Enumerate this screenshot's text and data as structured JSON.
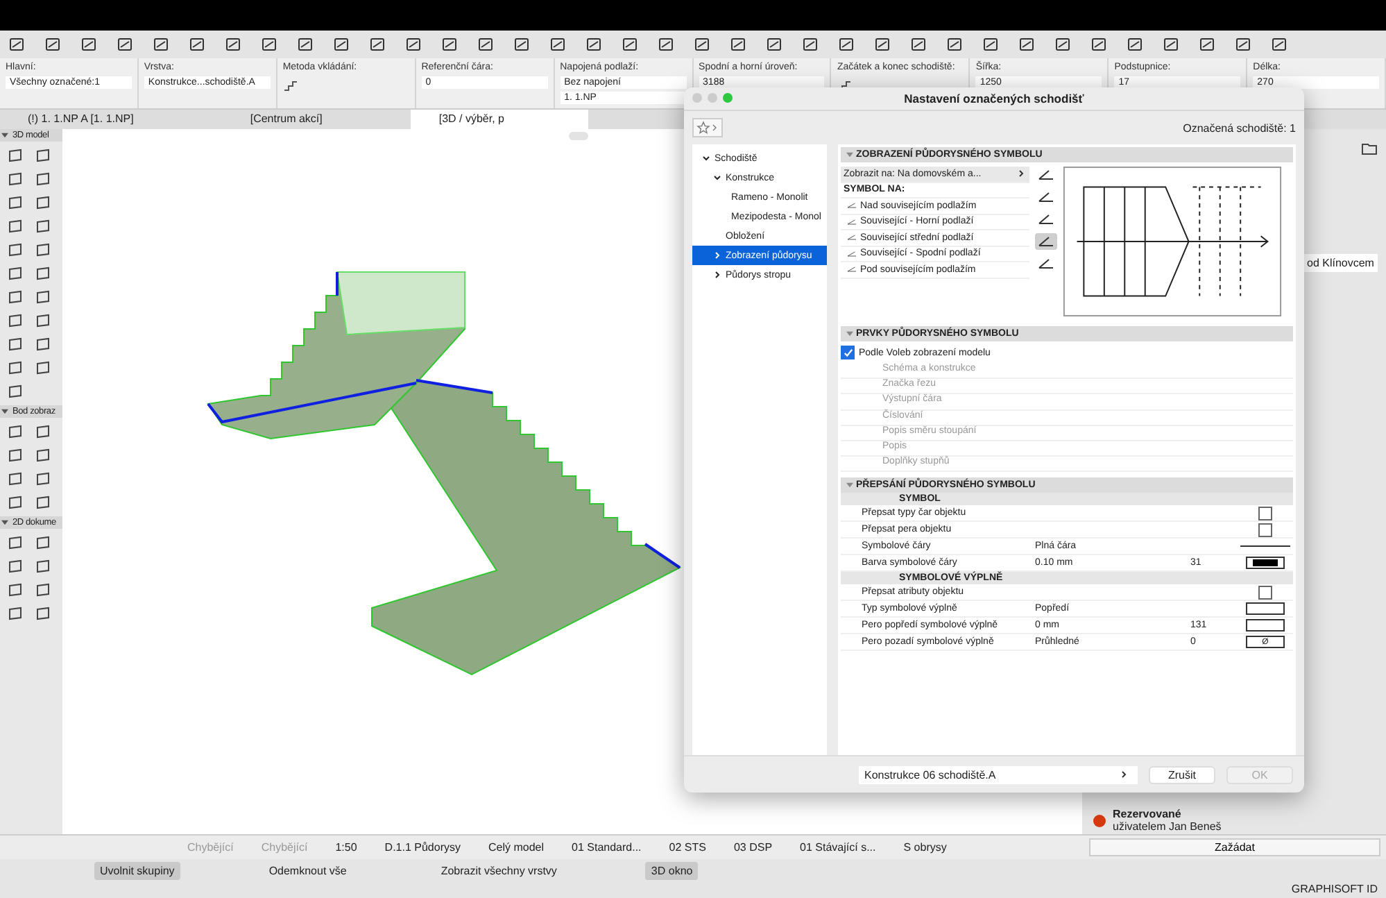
{
  "info_box": {
    "groups": [
      {
        "label": "Hlavní:",
        "values": [
          "Všechny označené:1"
        ]
      },
      {
        "label": "Vrstva:",
        "values": [
          "Konstrukce...schodiště.A"
        ]
      },
      {
        "label": "Metoda vkládání:"
      },
      {
        "label": "Referenční čára:",
        "values": [
          "0"
        ]
      },
      {
        "label": "Napojená podlaží:",
        "values": [
          "Bez napojení",
          "1. 1.NP"
        ]
      },
      {
        "label": "Spodní a horní úroveň:",
        "values": [
          "3188"
        ]
      },
      {
        "label": "Začátek a konec schodiště:"
      },
      {
        "label": "Šířka:",
        "values": [
          "1250"
        ]
      },
      {
        "label": "Podstupnice:",
        "values": [
          "17"
        ]
      },
      {
        "label": "Délka:",
        "values": [
          "270"
        ]
      }
    ]
  },
  "tabs": [
    {
      "label": "(!) 1. 1.NP A [1. 1.NP]",
      "selected": false
    },
    {
      "label": "[Centrum akcí]",
      "selected": false
    },
    {
      "label": "[3D / výběr, p",
      "selected": true
    }
  ],
  "toolbox": {
    "sections": [
      {
        "title": "3D model",
        "expanded": true
      },
      {
        "title": "Bod zobraz",
        "expanded": true
      },
      {
        "title": "2D dokume",
        "expanded": true
      }
    ]
  },
  "dialog": {
    "title": "Nastavení označených schodišť",
    "selection_count": "Označená schodiště: 1",
    "tree": [
      {
        "label": "Schodiště",
        "expanded": true,
        "selected": false,
        "children": [
          {
            "label": "Konstrukce",
            "expanded": true,
            "selected": false,
            "children": [
              {
                "label": "Rameno - Monolit",
                "selected": false
              },
              {
                "label": "Mezipodesta - Monol",
                "selected": false
              }
            ]
          },
          {
            "label": "Obložení",
            "selected": false
          },
          {
            "label": "Zobrazení půdorysu",
            "expanded": false,
            "selected": true
          },
          {
            "label": "Půdorys stropu",
            "expanded": false,
            "selected": false
          }
        ]
      }
    ],
    "plan_section": {
      "title": "ZOBRAZENÍ PŮDORYSNÉHO SYMBOLU",
      "show_on": "Zobrazit na: Na domovském a...",
      "symbol_heading": "SYMBOL NA:",
      "rows": [
        "Nad souvisejícím podlažím",
        "Související - Horní podlaží",
        "Související střední podlaží",
        "Související - Spodní podlaží",
        "Pod souvisejícím podlažím"
      ],
      "story_buttons": [
        {
          "selected": false
        },
        {
          "selected": false
        },
        {
          "selected": false
        },
        {
          "selected": true
        },
        {
          "selected": false
        }
      ]
    },
    "elements_section": {
      "title": "PRVKY PŮDORYSNÉHO SYMBOLU",
      "checkbox": {
        "label": "Podle Voleb zobrazení modelu",
        "checked": true
      },
      "items": [
        {
          "label": "Schéma a konstrukce",
          "disabled": true
        },
        {
          "label": "Značka řezu",
          "disabled": true
        },
        {
          "label": "Výstupní čára",
          "disabled": true
        },
        {
          "label": "Číslování",
          "disabled": true
        },
        {
          "label": "Popis směru stoupání",
          "disabled": true
        },
        {
          "label": "Popis",
          "disabled": true
        },
        {
          "label": "Doplňky stupňů",
          "disabled": true
        }
      ]
    },
    "override_section": {
      "title": "PŘEPSÁNÍ PŮDORYSNÉHO SYMBOLU",
      "groups": [
        {
          "title": "SYMBOL",
          "rows": [
            {
              "kind": "checkbox",
              "label": "Přepsat typy čar objektu",
              "checked": false
            },
            {
              "kind": "checkbox",
              "label": "Přepsat pera objektu",
              "checked": false
            },
            {
              "kind": "line",
              "label": "Symbolové čáry",
              "value": "Plná čára"
            },
            {
              "kind": "pen",
              "label": "Barva symbolové čáry",
              "value": "0.10 mm",
              "number": "31"
            }
          ]
        },
        {
          "title": "SYMBOLOVÉ VÝPLNĚ",
          "rows": [
            {
              "kind": "checkbox",
              "label": "Přepsat atributy objektu",
              "checked": false
            },
            {
              "kind": "swatch",
              "label": "Typ symbolové výplně",
              "value": "Popředí"
            },
            {
              "kind": "swatch",
              "label": "Pero popředí symbolové výplně",
              "value": "0 mm",
              "number": "131"
            },
            {
              "kind": "swatch",
              "label": "Pero pozadí symbolové výplně",
              "value": "Průhledné",
              "number": "0",
              "swatch_text": "Ø"
            }
          ]
        }
      ]
    },
    "layer": "Konstrukce 06 schodiště.A",
    "buttons": [
      {
        "label": "Zrušit",
        "disabled": false
      },
      {
        "label": "OK",
        "disabled": true
      }
    ]
  },
  "right_panel": {
    "list_item": "od Klínovcem",
    "status": {
      "title": "Rezervované",
      "detail": "uživatelem Jan Beneš",
      "color": "#d83a0e"
    },
    "request_button": "Zažádat"
  },
  "status_bar": {
    "items": [
      "Chybějící",
      "Chybějící",
      "1:50",
      "D.1.1 Půdorysy",
      "Celý model",
      "01 Standard...",
      "02 STS",
      "03 DSP",
      "01 Stávající s...",
      "S obrysy"
    ]
  },
  "bottom_toolbar": {
    "buttons": [
      {
        "label": "Uvolnit skupiny",
        "pressed": true
      },
      {
        "label": "Odemknout vše",
        "pressed": false
      },
      {
        "label": "Zobrazit všechny vrstvy",
        "pressed": false
      },
      {
        "label": "3D okno",
        "pressed": true
      }
    ]
  },
  "footer": {
    "brand": "GRAPHISOFT ID"
  }
}
